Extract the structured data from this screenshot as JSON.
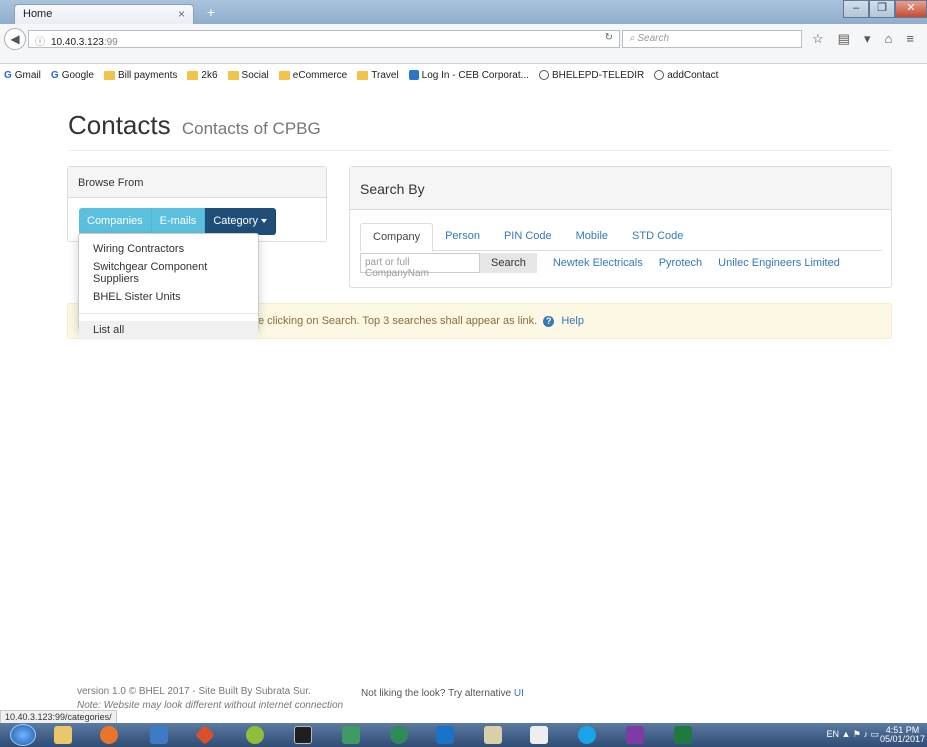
{
  "browser": {
    "tab_title": "Home",
    "tab_close": "×",
    "new_tab": "+",
    "url_host": "10.40.3.123",
    "url_port": ":99",
    "search_placeholder": "Search",
    "status_url": "10.40.3.123:99/categories/"
  },
  "bookmarks": [
    {
      "label": "Gmail",
      "icon": "google-icon"
    },
    {
      "label": "Google",
      "icon": "google-icon"
    },
    {
      "label": "Bill payments",
      "icon": "folder-icon"
    },
    {
      "label": "2k6",
      "icon": "folder-icon"
    },
    {
      "label": "Social",
      "icon": "folder-icon"
    },
    {
      "label": "eCommerce",
      "icon": "folder-icon"
    },
    {
      "label": "Travel",
      "icon": "folder-icon"
    },
    {
      "label": "Log In - CEB Corporat...",
      "icon": "page-icon"
    },
    {
      "label": "BHELEPD-TELEDIR",
      "icon": "globe-icon"
    },
    {
      "label": "addContact",
      "icon": "globe-icon"
    }
  ],
  "page": {
    "title": "Contacts",
    "subtitle": "Contacts of CPBG"
  },
  "browse": {
    "heading": "Browse From",
    "buttons": [
      "Companies",
      "E-mails",
      "Category"
    ]
  },
  "dropdown": {
    "items": [
      "Wiring Contractors",
      "Switchgear Component Suppliers",
      "BHEL Sister Units"
    ],
    "list_all": "List all"
  },
  "search": {
    "heading": "Search By",
    "tabs": [
      "Company",
      "Person",
      "PIN Code",
      "Mobile",
      "STD Code"
    ],
    "placeholder": "part or full CompanyNam",
    "button": "Search",
    "recent": [
      "Newtek Electricals",
      "Pyrotech",
      "Unilec Engineers Limited"
    ]
  },
  "alert": {
    "text": "e clicking on Search. Top 3 searches shall appear as link.",
    "help": "Help"
  },
  "footer": {
    "version": "version 1.0 © BHEL 2017 - Site Built By Subrata Sur.",
    "note": "Note: Website may look different without internet connection",
    "alt_prefix": "Not liking the look? Try alternative",
    "alt_link": "UI"
  },
  "taskbar": {
    "lang": "EN",
    "time": "4:51 PM",
    "date": "05/01/2017"
  }
}
